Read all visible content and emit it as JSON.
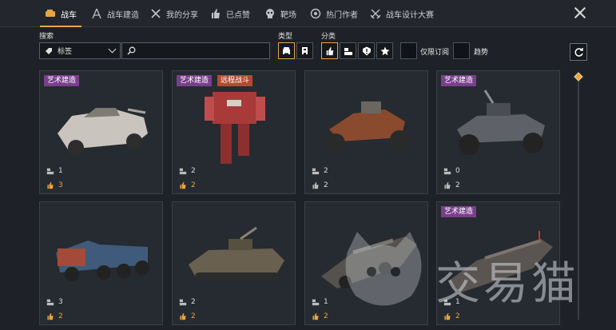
{
  "nav": {
    "tabs": [
      {
        "label": "战车",
        "icon": "vehicle-icon",
        "active": true
      },
      {
        "label": "战车建造",
        "icon": "build-icon"
      },
      {
        "label": "我的分享",
        "icon": "wrench-icon"
      },
      {
        "label": "已点赞",
        "icon": "thumbs-up-icon"
      },
      {
        "label": "靶场",
        "icon": "skull-icon"
      },
      {
        "label": "热门作者",
        "icon": "popular-author-icon"
      },
      {
        "label": "战车设计大赛",
        "icon": "crossed-swords-icon"
      }
    ]
  },
  "filters": {
    "search_label": "搜索",
    "tag_select_value": "标签",
    "search_placeholder": "",
    "type_label": "类型",
    "category_label": "分类",
    "subscribed_only_label": "仅限订阅",
    "trend_label": "趋势"
  },
  "cards": [
    {
      "tag": "艺术建造",
      "tag2": "",
      "builds": "1",
      "likes": "3"
    },
    {
      "tag": "艺术建造",
      "tag2": "远程战斗",
      "builds": "2",
      "likes": "2"
    },
    {
      "tag": "",
      "tag2": "",
      "builds": "2",
      "likes": "2"
    },
    {
      "tag": "艺术建造",
      "tag2": "",
      "builds": "0",
      "likes": "2"
    },
    {
      "tag": "",
      "tag2": "",
      "builds": "3",
      "likes": "2"
    },
    {
      "tag": "",
      "tag2": "",
      "builds": "2",
      "likes": "2"
    },
    {
      "tag": "",
      "tag2": "",
      "builds": "1",
      "likes": "2"
    },
    {
      "tag": "艺术建造",
      "tag2": "",
      "builds": "1",
      "likes": "2"
    }
  ],
  "watermark": "交易猫",
  "colors": {
    "accent": "#e9a540",
    "art_tag": "#7a3f8c",
    "melee_tag": "#b34a2d"
  }
}
